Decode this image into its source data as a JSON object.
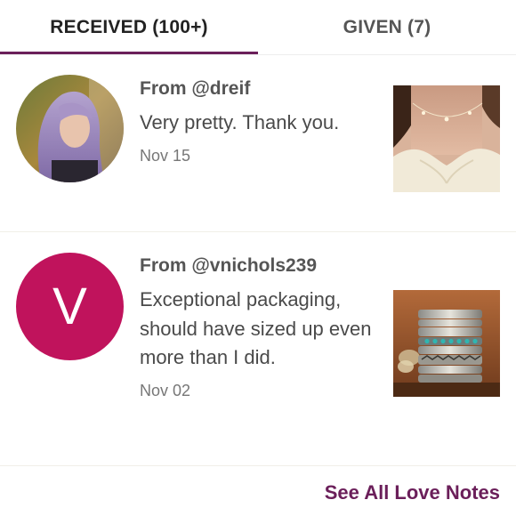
{
  "tabs": {
    "received_label": "RECEIVED (100+)",
    "given_label": "GIVEN (7)",
    "active_color": "#6b1f5a"
  },
  "notes": [
    {
      "from": "From @dreif",
      "message": "Very pretty. Thank you.",
      "date": "Nov 15",
      "avatar": "photo",
      "thumbnail": "necklace-photo"
    },
    {
      "from": "From @vnichols239",
      "message": "Exceptional packaging, should have sized up even more than I did.",
      "date": "Nov 02",
      "avatar_letter": "V",
      "avatar_color": "#c0135c",
      "thumbnail": "stacked-rings-photo"
    }
  ],
  "footer": {
    "see_all_label": "See All Love Notes"
  }
}
